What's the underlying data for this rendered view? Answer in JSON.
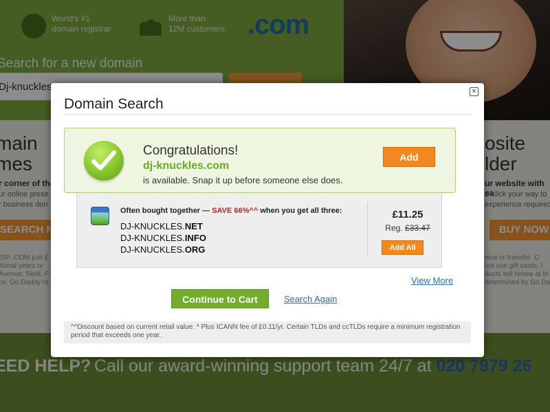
{
  "background": {
    "features": [
      {
        "line1": "World's #1",
        "line2": "domain registrar"
      },
      {
        "line1": "More than",
        "line2": "12M customers"
      }
    ],
    "com_logo": ".com",
    "search_label": "Search for a new domain",
    "search_value": "Dj-knuckles",
    "left_panel": {
      "heading_line1": "main",
      "heading_line2": "mes",
      "bold": "r corner of the",
      "line1": "ur online prese",
      "line2": "r business don",
      "button": "SEARCH N",
      "tiny1": "ER! .COM just £",
      "tiny2": "itional years or",
      "tiny3": "Avenue, Skrill, P",
      "tiny4": "ce. Go Daddy re"
    },
    "right_panel": {
      "heading_line1": "osite",
      "heading_line2": "lder",
      "bold": "ur website with ea",
      "line1": "d-click your way to",
      "line2": "experience required",
      "button": "BUY NOW",
      "tiny1": "new or transfer .C",
      "tiny2": "not use gift cards, l",
      "tiny3": "ducts will renew at th",
      "tiny4": "determined by Go Da"
    },
    "help": {
      "title": "EED HELP?",
      "text": "Call our award-winning support team 24/7 at ",
      "phone": "020 7979 26"
    }
  },
  "modal": {
    "title": "Domain Search",
    "close_label": "×",
    "success": {
      "heading": "Congratulations!",
      "domain": "dj-knuckles.com",
      "message": "is available. Snap it up before someone else does.",
      "add_label": "Add"
    },
    "bundle": {
      "head_prefix": "Often bought together — ",
      "save_text": "SAVE 66%^^",
      "head_suffix": " when you get all three:",
      "domains": [
        {
          "name": "DJ-KNUCKLES.",
          "tld": "NET"
        },
        {
          "name": "DJ-KNUCKLES.",
          "tld": "INFO"
        },
        {
          "name": "DJ-KNUCKLES.",
          "tld": "ORG"
        }
      ],
      "price": "£11.25",
      "reg_label": "Reg. ",
      "reg_price": "£33.47",
      "add_all_label": "Add All"
    },
    "view_more": "View More",
    "continue_label": "Continue to Cart",
    "search_again": "Search Again",
    "footnote": "^^Discount based on current retail value. * Plus ICANN fee of £0.11/yr. Certain TLDs and ccTLDs require a minimum registration period that exceeds one year."
  }
}
